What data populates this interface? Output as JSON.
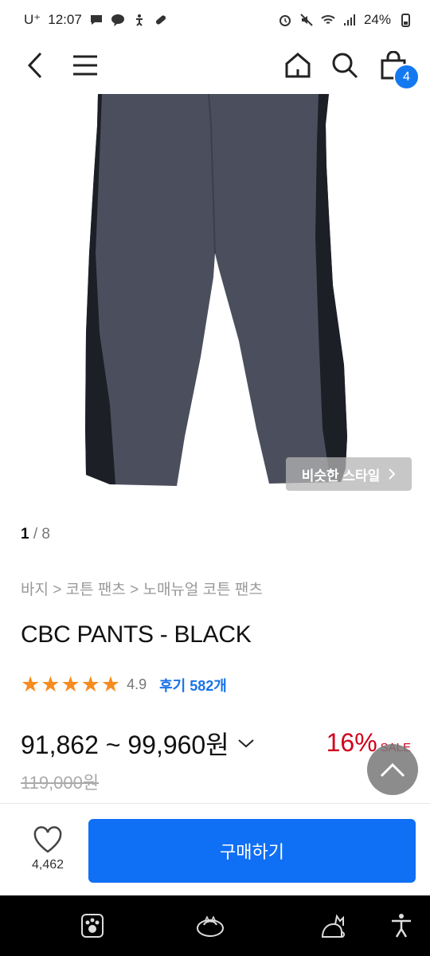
{
  "status_bar": {
    "carrier": "U⁺",
    "time": "12:07",
    "battery": "24%"
  },
  "nav": {
    "cart_count": "4"
  },
  "product": {
    "similar_style_label": "비슷한 스타일",
    "pager_current": "1",
    "pager_total": "/ 8",
    "breadcrumb": "바지 > 코튼 팬츠 > 노매뉴얼 코튼 팬츠",
    "title": "CBC PANTS - BLACK",
    "rating_score": "4.9",
    "review_link": "후기 582개",
    "price_range": "91,862 ~ 99,960원",
    "discount_rate": "16%",
    "sale_label": "SALE",
    "original_price": "119,000원"
  },
  "bottom_bar": {
    "like_count": "4,462",
    "buy_button": "구매하기"
  },
  "colors": {
    "accent": "#0f6ff5",
    "rating_star": "#f68b1f",
    "sale": "#d0021b"
  }
}
